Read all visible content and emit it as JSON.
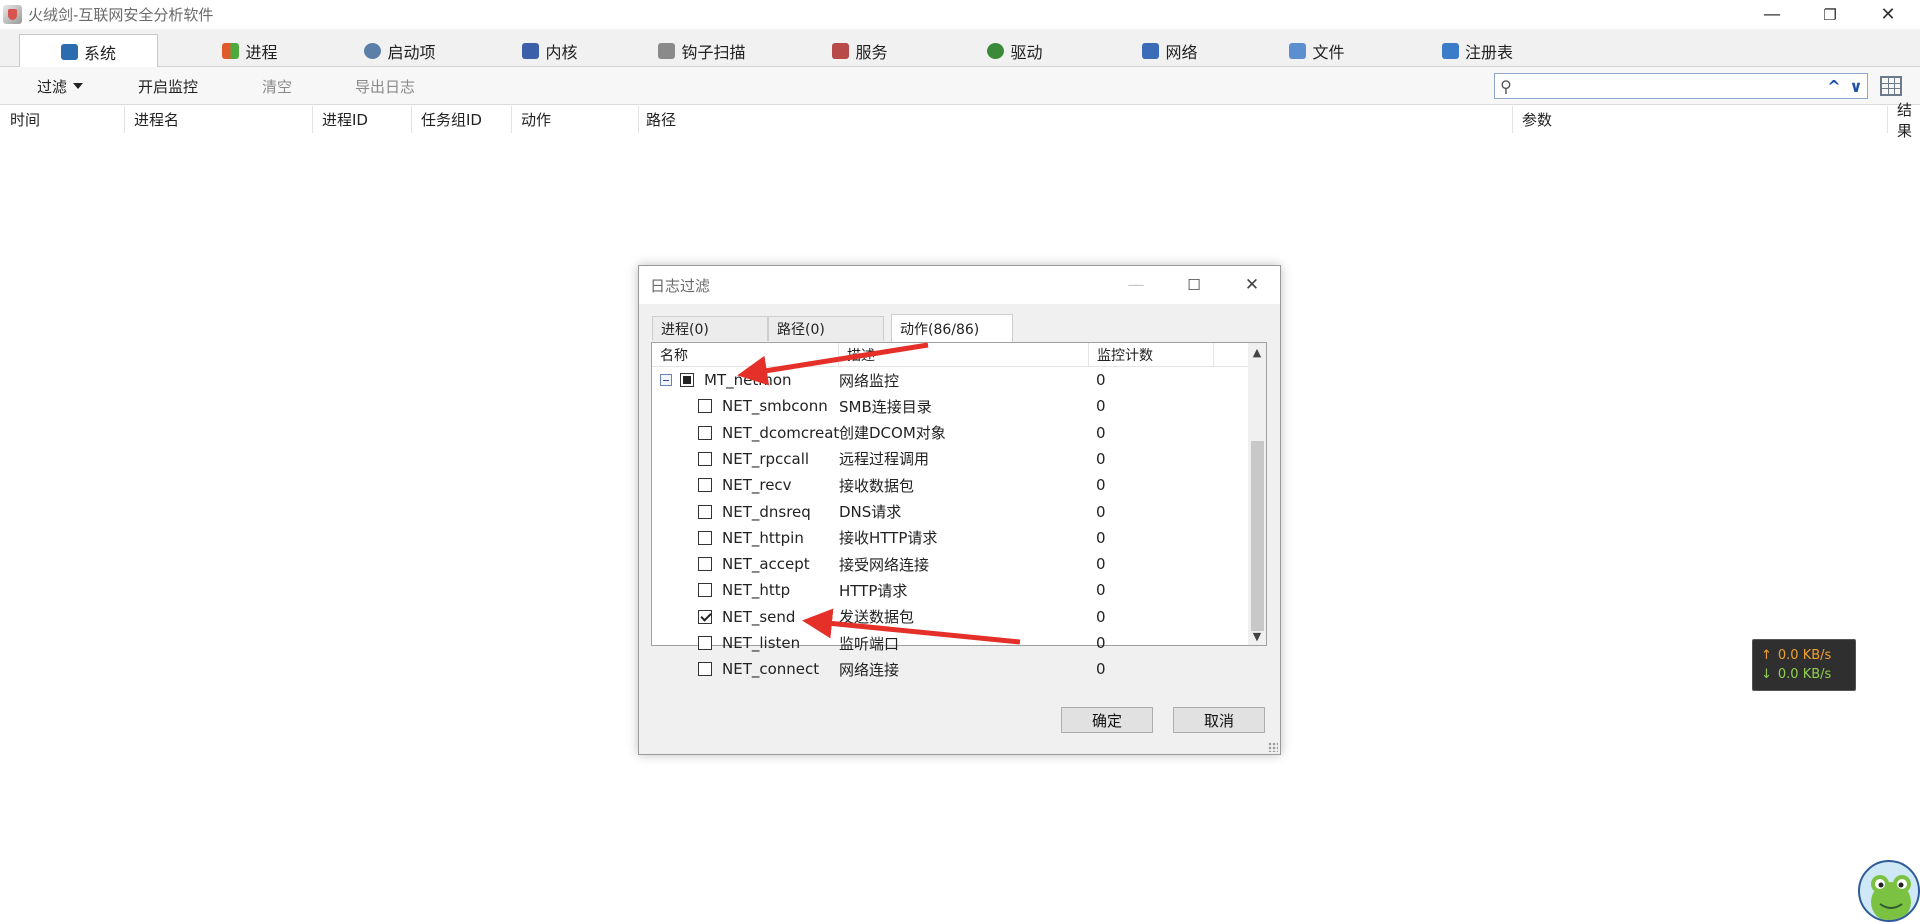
{
  "window": {
    "title": "火绒剑-互联网安全分析软件",
    "minimize": "—",
    "restore": "❐",
    "close": "✕"
  },
  "tabs": [
    {
      "label": "系统",
      "icon": "system-icon",
      "color": "#2b6cb0"
    },
    {
      "label": "进程",
      "icon": "windows-flag-icon",
      "color": "#e05a2b"
    },
    {
      "label": "启动项",
      "icon": "eye-icon",
      "color": "#5b7fa8"
    },
    {
      "label": "内核",
      "icon": "kernel-icon",
      "color": "#3b5fa8"
    },
    {
      "label": "钩子扫描",
      "icon": "hook-icon",
      "color": "#8a8a8a"
    },
    {
      "label": "服务",
      "icon": "service-icon",
      "color": "#b84a4a"
    },
    {
      "label": "驱动",
      "icon": "driver-icon",
      "color": "#3a8a3a"
    },
    {
      "label": "网络",
      "icon": "network-icon",
      "color": "#3b6cb8"
    },
    {
      "label": "文件",
      "icon": "file-icon",
      "color": "#5b8fd0"
    },
    {
      "label": "注册表",
      "icon": "registry-icon",
      "color": "#3b7cc8"
    }
  ],
  "toolbar": {
    "filter": "过滤",
    "start_monitor": "开启监控",
    "clear": "清空",
    "export_log": "导出日志",
    "search_value": ""
  },
  "columns": [
    "时间",
    "进程名",
    "进程ID",
    "任务组ID",
    "动作",
    "路径",
    "参数",
    "结果"
  ],
  "dialog": {
    "title": "日志过滤",
    "tabs": [
      "进程(0)",
      "路径(0)",
      "动作(86/86)"
    ],
    "active_tab": 2,
    "list_columns": [
      "名称",
      "描述",
      "监控计数"
    ],
    "rows": [
      {
        "name": "MT_netmon",
        "desc": "网络监控",
        "count": "0",
        "state": "partial",
        "level": 0
      },
      {
        "name": "NET_smbconn",
        "desc": "SMB连接目录",
        "count": "0",
        "state": "unchecked",
        "level": 1
      },
      {
        "name": "NET_dcomcreat",
        "desc": "创建DCOM对象",
        "count": "0",
        "state": "unchecked",
        "level": 1
      },
      {
        "name": "NET_rpccall",
        "desc": "远程过程调用",
        "count": "0",
        "state": "unchecked",
        "level": 1
      },
      {
        "name": "NET_recv",
        "desc": "接收数据包",
        "count": "0",
        "state": "unchecked",
        "level": 1
      },
      {
        "name": "NET_dnsreq",
        "desc": "DNS请求",
        "count": "0",
        "state": "unchecked",
        "level": 1
      },
      {
        "name": "NET_httpin",
        "desc": "接收HTTP请求",
        "count": "0",
        "state": "unchecked",
        "level": 1
      },
      {
        "name": "NET_accept",
        "desc": "接受网络连接",
        "count": "0",
        "state": "unchecked",
        "level": 1
      },
      {
        "name": "NET_http",
        "desc": "HTTP请求",
        "count": "0",
        "state": "unchecked",
        "level": 1
      },
      {
        "name": "NET_send",
        "desc": "发送数据包",
        "count": "0",
        "state": "checked",
        "level": 1
      },
      {
        "name": "NET_listen",
        "desc": "监听端口",
        "count": "0",
        "state": "unchecked",
        "level": 1
      },
      {
        "name": "NET_connect",
        "desc": "网络连接",
        "count": "0",
        "state": "unchecked",
        "level": 1
      }
    ],
    "ok": "确定",
    "cancel": "取消"
  },
  "speed": {
    "up": "0.0 KB/s",
    "down": "0.0 KB/s"
  },
  "colors": {
    "arrow": "#e5302a",
    "speed_up": "#f0a22e",
    "speed_down": "#8fd14f"
  }
}
